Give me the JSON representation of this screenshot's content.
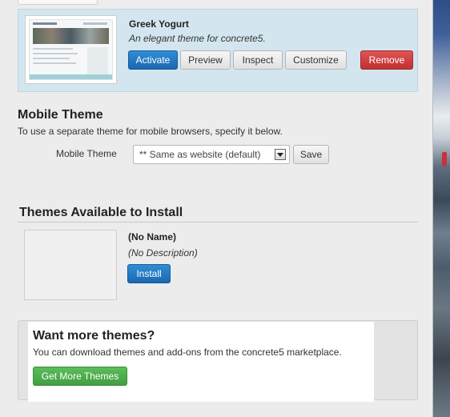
{
  "active_theme": {
    "name": "Greek Yogurt",
    "description": "An elegant theme for concrete5.",
    "buttons": {
      "activate": "Activate",
      "preview": "Preview",
      "inspect": "Inspect",
      "customize": "Customize",
      "remove": "Remove"
    }
  },
  "mobile_theme": {
    "heading": "Mobile Theme",
    "help": "To use a separate theme for mobile browsers, specify it below.",
    "label": "Mobile Theme",
    "selected": "** Same as website (default)",
    "save": "Save"
  },
  "available": {
    "heading": "Themes Available to Install",
    "items": [
      {
        "name": "(No Name)",
        "description": "(No Description)",
        "install": "Install"
      }
    ]
  },
  "marketplace": {
    "heading": "Want more themes?",
    "text": "You can download themes and add-ons from the concrete5 marketplace.",
    "button": "Get More Themes"
  },
  "colors": {
    "primary": "#2276c2",
    "danger": "#cf3b3b",
    "success": "#4cae4c",
    "active_row": "#d3e6ef"
  }
}
